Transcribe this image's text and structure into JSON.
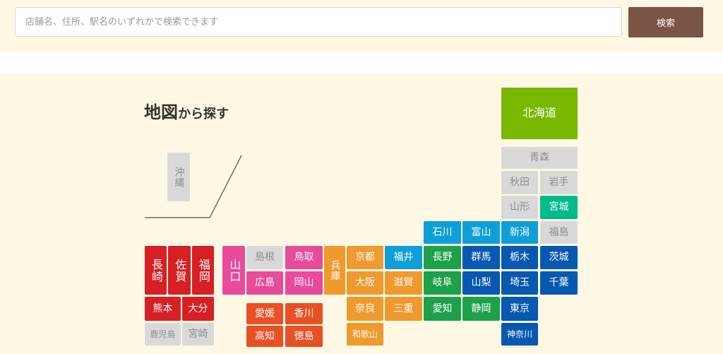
{
  "search": {
    "placeholder": "店舗名、住所、駅名のいずれかで検索できます",
    "button_label": "検索"
  },
  "map": {
    "title_main": "地図",
    "title_sub": "から探す"
  },
  "colors": {
    "hokkaido": "#78b800",
    "tohoku_gray": "#d9d9d9",
    "miyagi": "#00bb8c",
    "kanto": "#0758b0",
    "koshinetsu": "#0e9fd8",
    "tokai": "#1da14a",
    "kinki": "#ef9a2e",
    "chugoku": "#ea4a9b",
    "shikoku": "#e85025",
    "kyushu": "#d71f24"
  },
  "prefectures": {
    "hokkaido": "北海道",
    "aomori": "青森",
    "akita": "秋田",
    "iwate": "岩手",
    "yamagata": "山形",
    "miyagi": "宮城",
    "niigata": "新潟",
    "fukushima": "福島",
    "ishikawa": "石川",
    "toyama": "富山",
    "fukui": "福井",
    "nagano": "長野",
    "gunma": "群馬",
    "tochigi": "栃木",
    "ibaraki": "茨城",
    "gifu": "岐阜",
    "yamanashi": "山梨",
    "saitama": "埼玉",
    "chiba": "千葉",
    "aichi": "愛知",
    "shizuoka": "静岡",
    "tokyo": "東京",
    "kanagawa": "神奈川",
    "kyoto": "京都",
    "shiga": "滋賀",
    "osaka": "大阪",
    "nara": "奈良",
    "mie": "三重",
    "wakayama": "和歌山",
    "hyogo": "兵庫",
    "tottori": "鳥取",
    "shimane": "島根",
    "okayama": "岡山",
    "hiroshima": "広島",
    "yamaguchi": "山口",
    "kagawa": "香川",
    "ehime": "愛媛",
    "tokushima": "徳島",
    "kochi": "高知",
    "fukuoka": "福岡",
    "saga": "佐賀",
    "nagasaki": "長崎",
    "oita": "大分",
    "kumamoto": "熊本",
    "miyazaki": "宮崎",
    "kagoshima": "鹿児島",
    "okinawa": "沖縄"
  }
}
